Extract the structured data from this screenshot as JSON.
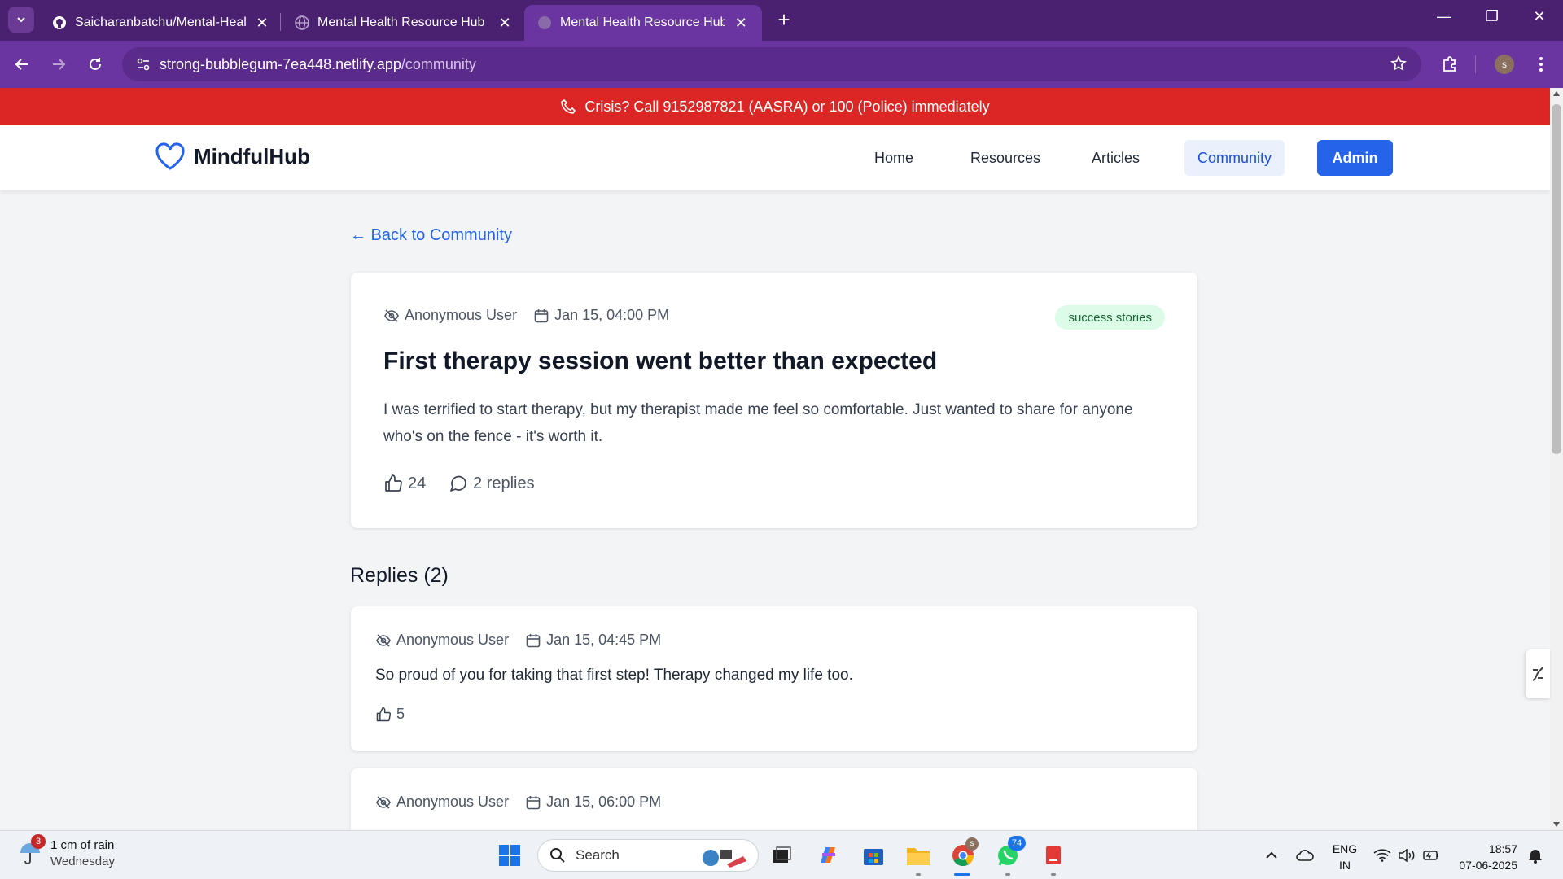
{
  "browser": {
    "tabs": [
      {
        "title": "Saicharanbatchu/Mental-Healt",
        "favicon": "github-icon"
      },
      {
        "title": "Mental Health Resource Hub - S",
        "favicon": "globe-icon"
      },
      {
        "title": "Mental Health Resource Hub - S",
        "favicon": "globe-icon",
        "active": true
      }
    ],
    "url_host": "strong-bubblegum-7ea448.netlify.app",
    "url_path": "/community",
    "profile_initial": "s"
  },
  "crisis_banner": {
    "text": "Crisis? Call 9152987821 (AASRA) or 100 (Police) immediately",
    "color": "#dc2626"
  },
  "header": {
    "brand": "MindfulHub",
    "nav": [
      {
        "label": "Home"
      },
      {
        "label": "Resources"
      },
      {
        "label": "Articles"
      },
      {
        "label": "Community",
        "current": true
      },
      {
        "label": "Admin"
      }
    ],
    "accent_color": "#2563eb"
  },
  "back_link": "← Back to Community",
  "post": {
    "author": "Anonymous User",
    "date": "Jan 15, 04:00 PM",
    "category": "success stories",
    "title": "First therapy session went better than expected",
    "body": "I was terrified to start therapy, but my therapist made me feel so comfortable. Just wanted to share for anyone who's on the fence - it's worth it.",
    "likes": "24",
    "replies_label": "2 replies"
  },
  "replies": {
    "heading": "Replies (2)",
    "items": [
      {
        "author": "Anonymous User",
        "date": "Jan 15, 04:45 PM",
        "text": "So proud of you for taking that first step! Therapy changed my life too.",
        "likes": "5"
      },
      {
        "author": "Anonymous User",
        "date": "Jan 15, 06:00 PM"
      }
    ]
  },
  "taskbar": {
    "weather_badge": "3",
    "weather_line1": "1 cm of rain",
    "weather_line2": "Wednesday",
    "search_placeholder": "Search",
    "chrome_badge": "s",
    "whatsapp_badge": "74",
    "lang_line1": "ENG",
    "lang_line2": "IN",
    "time": "18:57",
    "date": "07-06-2025"
  }
}
